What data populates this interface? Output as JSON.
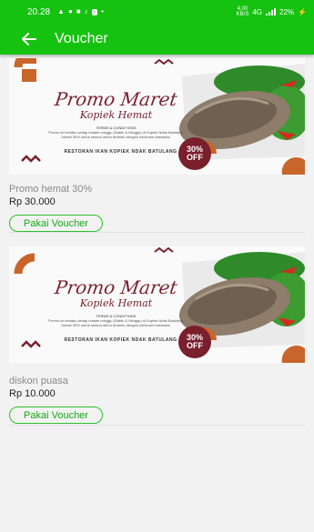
{
  "status_bar": {
    "time": "20.28",
    "left_icons": [
      "notification-icon",
      "chat-icon",
      "game-icon",
      "tiktok-icon",
      "message-badge-icon",
      "dot-icon"
    ],
    "badge": "▫",
    "net_speed": "4,00",
    "net_unit": "KB/S",
    "network": "4G",
    "battery": "22%"
  },
  "appbar": {
    "title": "Voucher",
    "back_icon": "arrow-left-icon"
  },
  "vouchers": [
    {
      "banner": {
        "title": "Promo Maret",
        "subtitle": "Kopiek Hemat",
        "terms_heading": "TERMS & CONDITIONS",
        "terms": "Promo ini berlaku setiap malam minggu (Sabtu & Minggu) di Kopiek Ndak Batulang, hemat 30% untuk semua menu tertentu dengan minimum transaksi.",
        "restaurant": "RESTORAN IKAN KOPIEK NDAK BATULANG",
        "discount": "30%",
        "off": "OFF"
      },
      "name": "Promo hemat 30%",
      "price": "Rp 30.000",
      "button": "Pakai Voucher"
    },
    {
      "banner": {
        "title": "Promo Maret",
        "subtitle": "Kopiek Hemat",
        "terms_heading": "TERMS & CONDITIONS",
        "terms": "Promo ini berlaku setiap malam minggu (Sabtu & Minggu) di Kopiek Ndak Batulang, hemat 30% untuk semua menu tertentu dengan minimum transaksi.",
        "restaurant": "RESTORAN IKAN KOPIEK NDAK BATULANG",
        "discount": "30%",
        "off": "OFF"
      },
      "name": "diskon puasa",
      "price": "Rp 10.000",
      "button": "Pakai Voucher"
    }
  ],
  "colors": {
    "primary": "#15c20f",
    "accent_text": "#17a817",
    "banner_maroon": "#7a1f2c",
    "banner_orange": "#c8652a"
  }
}
